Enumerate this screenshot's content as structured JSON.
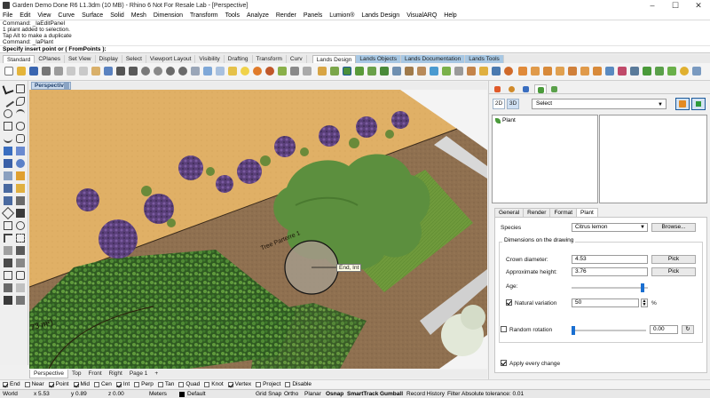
{
  "window": {
    "title": "Garden Demo Done R6 L1.3dm (10 MB) - Rhino 6 Not For Resale Lab - [Perspective]",
    "controls": [
      "–",
      "☐",
      "✕"
    ]
  },
  "menu": [
    "File",
    "Edit",
    "View",
    "Curve",
    "Surface",
    "Solid",
    "Mesh",
    "Dimension",
    "Transform",
    "Tools",
    "Analyze",
    "Render",
    "Panels",
    "Lumion®",
    "Lands Design",
    "VisualARQ",
    "Help"
  ],
  "command": {
    "history": [
      "Command: _laEditPanel",
      "1 plant added to selection.",
      "Tap Alt to make a duplicate",
      "Command: _laPlant"
    ],
    "prompt": "Specify insert point or ( FromPoints ):"
  },
  "toolbar_tabs": [
    "Standard",
    "CPlanes",
    "Set View",
    "Display",
    "Select",
    "Viewport Layout",
    "Visibility",
    "Drafting",
    "Transform",
    "Curv"
  ],
  "lands_tabs": [
    "Lands Design",
    "Lands Objects",
    "Lands Documentation",
    "Lands Tools"
  ],
  "viewport": {
    "label": "Perspective",
    "tabs": [
      "Perspective",
      "Top",
      "Front",
      "Right",
      "Page 1",
      "+"
    ],
    "tooltip": "End, Int",
    "annotation_a": "Tree Parterre 1",
    "annotation_b": "73 m²)"
  },
  "osnaps": [
    {
      "label": "End",
      "on": true
    },
    {
      "label": "Near",
      "on": false
    },
    {
      "label": "Point",
      "on": true
    },
    {
      "label": "Mid",
      "on": true
    },
    {
      "label": "Cen",
      "on": false
    },
    {
      "label": "Int",
      "on": true
    },
    {
      "label": "Perp",
      "on": false
    },
    {
      "label": "Tan",
      "on": false
    },
    {
      "label": "Quad",
      "on": false
    },
    {
      "label": "Knot",
      "on": false
    },
    {
      "label": "Vertex",
      "on": true
    },
    {
      "label": "Project",
      "on": false
    },
    {
      "label": "Disable",
      "on": false
    }
  ],
  "status": {
    "cplane": "World",
    "x": "x 5.53",
    "y": "y 0.89",
    "z": "z 0.00",
    "units": "Meters",
    "layer": "Default",
    "grid_snap": "Grid Snap",
    "ortho": "Ortho",
    "planar": "Planar",
    "osnap": "Osnap",
    "smarttrack": "SmartTrack",
    "gumball": "Gumball",
    "record_history": "Record History",
    "filter": "Filter",
    "tolerance": "Absolute tolerance: 0.01"
  },
  "panel": {
    "btn_2d": "2D",
    "btn_3d": "3D",
    "select": "Select",
    "tree_item": "Plant",
    "tabs": [
      "General",
      "Render",
      "Format",
      "Plant"
    ],
    "species_label": "Species",
    "species_value": "Citrus lemon",
    "browse": "Browse...",
    "dims_title": "Dimensions on the drawing",
    "crown_label": "Crown diameter:",
    "crown_value": "4.53",
    "height_label": "Approximate height:",
    "height_value": "3.76",
    "pick": "Pick",
    "age_label": "Age:",
    "age_level": 0.95,
    "natvar_label": "Natural variation",
    "natvar_checked": true,
    "natvar_value": "50",
    "percent": "%",
    "randrot_label": "Random rotation",
    "randrot_checked": false,
    "randrot_value": "0.00",
    "apply_label": "Apply every change",
    "apply_checked": true
  },
  "colors": {
    "ground": "#e0b066",
    "path": "#8f7050",
    "lawn": "#6f9a3c",
    "tree_canopy": "#5c8f3e",
    "lavender": "#6a4c8c",
    "accent": "#1a6fd1"
  }
}
